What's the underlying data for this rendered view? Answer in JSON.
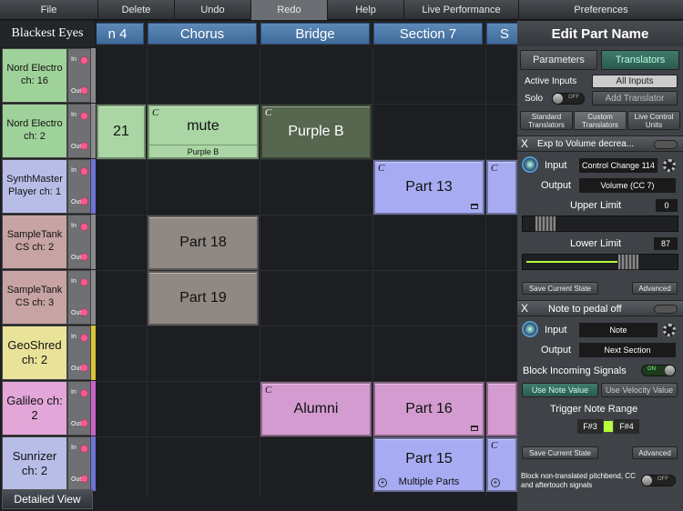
{
  "menu": {
    "items": [
      "File",
      "Delete",
      "Undo",
      "Redo",
      "Help",
      "Live Performance",
      "Preferences"
    ],
    "active": "Redo"
  },
  "song_title": "Blackest Eyes",
  "sections": [
    "n 4",
    "Chorus",
    "Bridge",
    "Section 7",
    "S"
  ],
  "tracks": [
    {
      "name": "Nord Electro ch: 16",
      "color": "#9fd29a",
      "bar": "#8a8a8a"
    },
    {
      "name": "Nord Electro ch: 2",
      "color": "#9fd29a",
      "bar": "#8a8a8a"
    },
    {
      "name": "SynthMaster Player ch: 1",
      "color": "#b8bde8",
      "bar": "#6c72d8"
    },
    {
      "name": "SampleTank CS ch: 2",
      "color": "#c7a3a3",
      "bar": "#8a8a8a"
    },
    {
      "name": "SampleTank CS ch: 3",
      "color": "#c7a3a3",
      "bar": "#8a8a8a"
    },
    {
      "name": "GeoShred ch: 2",
      "color": "#e9e39a",
      "bar": "#d8c23a"
    },
    {
      "name": "Galileo ch: 2",
      "color": "#e2a6d8",
      "bar": "#c864c8"
    },
    {
      "name": "Sunrizer ch: 2",
      "color": "#b8bde8",
      "bar": "#6c72d8"
    }
  ],
  "io": {
    "in": "In",
    "out": "Out"
  },
  "detailed_view": "Detailed View",
  "clips": [
    {
      "label": "21",
      "color": "#a9d6a4"
    },
    {
      "label": "mute",
      "sub": "Purple B",
      "color": "#a9d6a4",
      "c": "C"
    },
    {
      "label": "Purple B",
      "color": "#56664f",
      "c": "C",
      "text": "#fff"
    },
    {
      "label": "Part 13",
      "color": "#a7acf2",
      "c": "C",
      "mini": true
    },
    {
      "label": "",
      "color": "#a7acf2",
      "c": "C"
    },
    {
      "label": "Part 18",
      "color": "#8f8883"
    },
    {
      "label": "Part 19",
      "color": "#8f8883"
    },
    {
      "label": "Alumni",
      "color": "#d39bd0",
      "c": "C"
    },
    {
      "label": "Part 16",
      "color": "#d39bd0",
      "mini": true
    },
    {
      "label": "",
      "color": "#d39bd0"
    },
    {
      "label": "Part 15",
      "sub": "Multiple Parts",
      "color": "#a7acf2",
      "plus": true
    },
    {
      "label": "",
      "color": "#a7acf2",
      "c": "C",
      "plus": true
    }
  ],
  "panel": {
    "title": "Edit Part Name",
    "tabs": [
      "Parameters",
      "Translators"
    ],
    "active_inputs_label": "Active Inputs",
    "all_inputs": "All Inputs",
    "solo_label": "Solo",
    "off": "OFF",
    "on": "ON",
    "add_translator": "Add Translator",
    "subtabs": [
      "Standard Translators",
      "Custom Translators",
      "Live Control Units"
    ],
    "t1": {
      "x": "X",
      "name": "Exp to Volume decrea...",
      "input_label": "Input",
      "input_value": "Control Change 114",
      "output_label": "Output",
      "output_value": "Volume  (CC 7)",
      "upper_label": "Upper Limit",
      "upper_value": "0",
      "upper_level": 0.09,
      "lower_label": "Lower Limit",
      "lower_value": "87",
      "lower_level": 0.7,
      "save": "Save Current State",
      "advanced": "Advanced"
    },
    "t2": {
      "x": "X",
      "name": "Note to pedal off",
      "input_label": "Input",
      "input_value": "Note",
      "output_label": "Output",
      "output_value": "Next Section",
      "block_label": "Block Incoming Signals",
      "use_note": "Use Note Value",
      "use_velocity": "Use Velocity Value",
      "trigger_label": "Trigger Note Range",
      "range_low": "F#3",
      "range_high": "F#4",
      "save": "Save Current State",
      "advanced": "Advanced"
    },
    "footer": "Block non-translated pitchbend, CC and aftertouch signals"
  }
}
